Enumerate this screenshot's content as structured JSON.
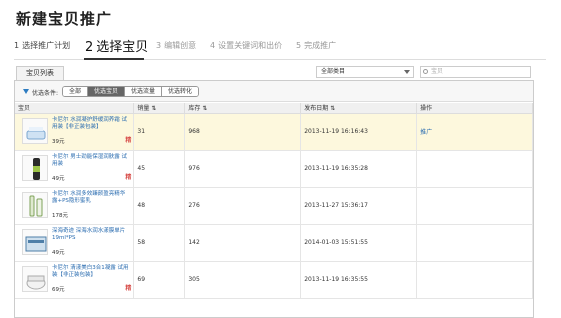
{
  "page": {
    "title": "新建宝贝推广"
  },
  "steps": [
    {
      "num": "1",
      "label": "选择推广计划"
    },
    {
      "num": "2",
      "label": "选择宝贝"
    },
    {
      "num": "3",
      "label": "编辑创意"
    },
    {
      "num": "4",
      "label": "设置关键词和出价"
    },
    {
      "num": "5",
      "label": "完成推广"
    }
  ],
  "tab_label": "宝贝列表",
  "category": {
    "selected": "全部类目"
  },
  "search": {
    "placeholder": "宝贝"
  },
  "filter": {
    "label": "优选条件:",
    "options": [
      "全部",
      "优选宝贝",
      "优选流量",
      "优选转化"
    ],
    "active_index": 1
  },
  "table": {
    "headers": [
      "宝贝",
      "销量",
      "库存",
      "发布日期",
      "操作"
    ],
    "rows": [
      {
        "name": "卡尼尔 水润凝护舒缓润养霜 试用装【非正装包装】",
        "price": "39元",
        "sales": "31",
        "stock": "968",
        "date": "2013-11-19 16:16:43",
        "action": "推广",
        "jing": "精",
        "highlight": true
      },
      {
        "name": "卡尼尔 男士劲能保湿润肤露 试用装",
        "price": "49元",
        "sales": "45",
        "stock": "976",
        "date": "2013-11-19 16:35:28",
        "action": "",
        "jing": "精",
        "highlight": false
      },
      {
        "name": "卡尼尔 水润多效臻颜盈亮精华露+PS隐形蜜乳",
        "price": "178元",
        "sales": "48",
        "stock": "276",
        "date": "2013-11-27 15:36:17",
        "action": "",
        "jing": "",
        "highlight": false
      },
      {
        "name": "深海奇迹 深海水润水漾膜单片19ml*PS",
        "price": "49元",
        "sales": "58",
        "stock": "142",
        "date": "2014-01-03 15:51:55",
        "action": "",
        "jing": "",
        "highlight": false
      },
      {
        "name": "卡尼尔 清漾美白3合1凝露 试用装【非正装包装】",
        "price": "69元",
        "sales": "69",
        "stock": "305",
        "date": "2013-11-19 16:35:55",
        "action": "",
        "jing": "精",
        "highlight": false
      }
    ]
  },
  "colors": {
    "link": "#2a6cb0",
    "highlight_row": "#fdf8dd",
    "jing": "#d9534f"
  }
}
